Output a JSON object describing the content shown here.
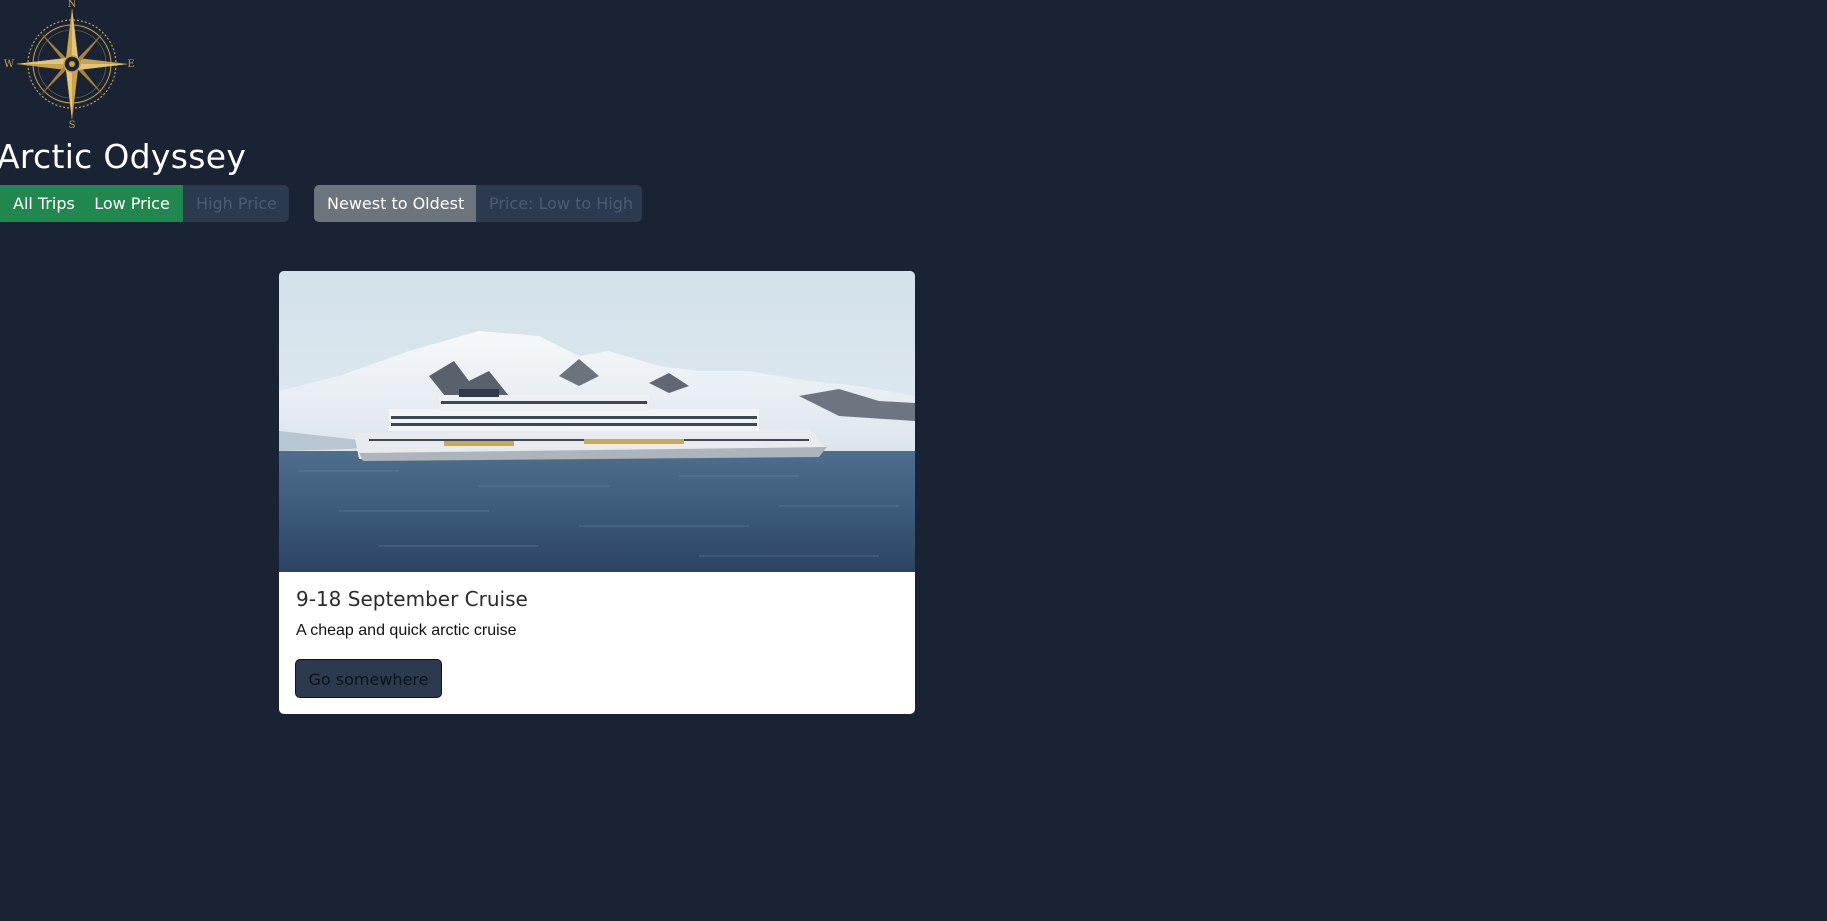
{
  "logo": {
    "north": "N",
    "south": "S",
    "east": "E",
    "west": "W",
    "icon": "compass-rose-icon"
  },
  "title": "Arctic Odyssey",
  "filters": {
    "all": "All Trips",
    "low": "Low Price",
    "high": "High Price"
  },
  "sort": {
    "newest": "Newest to Oldest",
    "price": "Price: Low to High"
  },
  "card": {
    "title": "9-18 September Cruise",
    "text": "A cheap and quick arctic cruise",
    "button": "Go somewhere"
  },
  "colors": {
    "background": "#192333",
    "success": "#20884f",
    "muted": "#2c3a4f",
    "gray": "#6c757d",
    "gold": "#c9a24a"
  }
}
